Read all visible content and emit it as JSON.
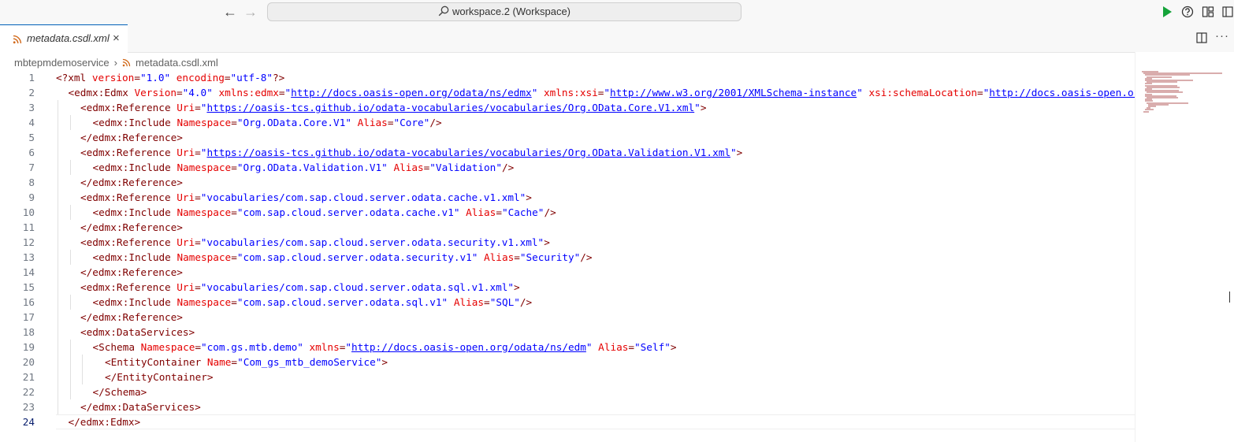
{
  "titlebar": {
    "back_glyph": "←",
    "forward_glyph": "→",
    "command_center_label": "workspace.2 (Workspace)"
  },
  "icons": {
    "search": "search-icon",
    "run": "play-icon",
    "help": "help-circle-icon",
    "layout": "layout-icon",
    "rss": "rss-feed-icon",
    "close": "close-icon",
    "split": "split-editor-icon",
    "more": "ellipsis-icon"
  },
  "colors": {
    "run_green": "#15a33a",
    "rss_orange": "#d1691a",
    "tag": "#800000",
    "attribute": "#e50000",
    "string": "#0000ff",
    "line_number": "#6e7681"
  },
  "tab": {
    "label": "metadata.csdl.xml",
    "close_glyph": "×",
    "more_glyph": "···"
  },
  "breadcrumb": {
    "folder": "mbtepmdemoservice",
    "separator": "›",
    "file": "metadata.csdl.xml"
  },
  "editor": {
    "current_line": 24,
    "lines": [
      {
        "n": "1",
        "indent": 0,
        "t": [
          [
            "p",
            "<?"
          ],
          [
            "g",
            "xml"
          ],
          [
            "a",
            " version"
          ],
          [
            "p",
            "="
          ],
          [
            "s",
            "\"1.0\""
          ],
          [
            "a",
            " encoding"
          ],
          [
            "p",
            "="
          ],
          [
            "s",
            "\"utf-8\""
          ],
          [
            "p",
            "?>"
          ]
        ]
      },
      {
        "n": "2",
        "indent": 1,
        "t": [
          [
            "p",
            "<"
          ],
          [
            "g",
            "edmx:Edmx"
          ],
          [
            "a",
            " Version"
          ],
          [
            "p",
            "="
          ],
          [
            "s",
            "\"4.0\""
          ],
          [
            "a",
            " xmlns:edmx"
          ],
          [
            "p",
            "="
          ],
          [
            "s",
            "\""
          ],
          [
            "l",
            "http://docs.oasis-open.org/odata/ns/edmx"
          ],
          [
            "s",
            "\""
          ],
          [
            "a",
            " xmlns:xsi"
          ],
          [
            "p",
            "="
          ],
          [
            "s",
            "\""
          ],
          [
            "l",
            "http://www.w3.org/2001/XMLSchema-instance"
          ],
          [
            "s",
            "\""
          ],
          [
            "a",
            " xsi:schemaLocation"
          ],
          [
            "p",
            "="
          ],
          [
            "s",
            "\""
          ],
          [
            "l",
            "http://docs.oasis-open.org/odata/ns/edmx"
          ]
        ]
      },
      {
        "n": "3",
        "indent": 2,
        "t": [
          [
            "p",
            "<"
          ],
          [
            "g",
            "edmx:Reference"
          ],
          [
            "a",
            " Uri"
          ],
          [
            "p",
            "="
          ],
          [
            "s",
            "\""
          ],
          [
            "l",
            "https://oasis-tcs.github.io/odata-vocabularies/vocabularies/Org.OData.Core.V1.xml"
          ],
          [
            "s",
            "\""
          ],
          [
            "p",
            ">"
          ]
        ]
      },
      {
        "n": "4",
        "indent": 3,
        "t": [
          [
            "p",
            "<"
          ],
          [
            "g",
            "edmx:Include"
          ],
          [
            "a",
            " Namespace"
          ],
          [
            "p",
            "="
          ],
          [
            "s",
            "\"Org.OData.Core.V1\""
          ],
          [
            "a",
            " Alias"
          ],
          [
            "p",
            "="
          ],
          [
            "s",
            "\"Core\""
          ],
          [
            "p",
            "/>"
          ]
        ]
      },
      {
        "n": "5",
        "indent": 2,
        "t": [
          [
            "p",
            "</"
          ],
          [
            "g",
            "edmx:Reference"
          ],
          [
            "p",
            ">"
          ]
        ]
      },
      {
        "n": "6",
        "indent": 2,
        "t": [
          [
            "p",
            "<"
          ],
          [
            "g",
            "edmx:Reference"
          ],
          [
            "a",
            " Uri"
          ],
          [
            "p",
            "="
          ],
          [
            "s",
            "\""
          ],
          [
            "l",
            "https://oasis-tcs.github.io/odata-vocabularies/vocabularies/Org.OData.Validation.V1.xml"
          ],
          [
            "s",
            "\""
          ],
          [
            "p",
            ">"
          ]
        ]
      },
      {
        "n": "7",
        "indent": 3,
        "t": [
          [
            "p",
            "<"
          ],
          [
            "g",
            "edmx:Include"
          ],
          [
            "a",
            " Namespace"
          ],
          [
            "p",
            "="
          ],
          [
            "s",
            "\"Org.OData.Validation.V1\""
          ],
          [
            "a",
            " Alias"
          ],
          [
            "p",
            "="
          ],
          [
            "s",
            "\"Validation\""
          ],
          [
            "p",
            "/>"
          ]
        ]
      },
      {
        "n": "8",
        "indent": 2,
        "t": [
          [
            "p",
            "</"
          ],
          [
            "g",
            "edmx:Reference"
          ],
          [
            "p",
            ">"
          ]
        ]
      },
      {
        "n": "9",
        "indent": 2,
        "t": [
          [
            "p",
            "<"
          ],
          [
            "g",
            "edmx:Reference"
          ],
          [
            "a",
            " Uri"
          ],
          [
            "p",
            "="
          ],
          [
            "s",
            "\"vocabularies/com.sap.cloud.server.odata.cache.v1.xml\""
          ],
          [
            "p",
            ">"
          ]
        ]
      },
      {
        "n": "10",
        "indent": 3,
        "t": [
          [
            "p",
            "<"
          ],
          [
            "g",
            "edmx:Include"
          ],
          [
            "a",
            " Namespace"
          ],
          [
            "p",
            "="
          ],
          [
            "s",
            "\"com.sap.cloud.server.odata.cache.v1\""
          ],
          [
            "a",
            " Alias"
          ],
          [
            "p",
            "="
          ],
          [
            "s",
            "\"Cache\""
          ],
          [
            "p",
            "/>"
          ]
        ]
      },
      {
        "n": "11",
        "indent": 2,
        "t": [
          [
            "p",
            "</"
          ],
          [
            "g",
            "edmx:Reference"
          ],
          [
            "p",
            ">"
          ]
        ]
      },
      {
        "n": "12",
        "indent": 2,
        "t": [
          [
            "p",
            "<"
          ],
          [
            "g",
            "edmx:Reference"
          ],
          [
            "a",
            " Uri"
          ],
          [
            "p",
            "="
          ],
          [
            "s",
            "\"vocabularies/com.sap.cloud.server.odata.security.v1.xml\""
          ],
          [
            "p",
            ">"
          ]
        ]
      },
      {
        "n": "13",
        "indent": 3,
        "t": [
          [
            "p",
            "<"
          ],
          [
            "g",
            "edmx:Include"
          ],
          [
            "a",
            " Namespace"
          ],
          [
            "p",
            "="
          ],
          [
            "s",
            "\"com.sap.cloud.server.odata.security.v1\""
          ],
          [
            "a",
            " Alias"
          ],
          [
            "p",
            "="
          ],
          [
            "s",
            "\"Security\""
          ],
          [
            "p",
            "/>"
          ]
        ]
      },
      {
        "n": "14",
        "indent": 2,
        "t": [
          [
            "p",
            "</"
          ],
          [
            "g",
            "edmx:Reference"
          ],
          [
            "p",
            ">"
          ]
        ]
      },
      {
        "n": "15",
        "indent": 2,
        "t": [
          [
            "p",
            "<"
          ],
          [
            "g",
            "edmx:Reference"
          ],
          [
            "a",
            " Uri"
          ],
          [
            "p",
            "="
          ],
          [
            "s",
            "\"vocabularies/com.sap.cloud.server.odata.sql.v1.xml\""
          ],
          [
            "p",
            ">"
          ]
        ]
      },
      {
        "n": "16",
        "indent": 3,
        "t": [
          [
            "p",
            "<"
          ],
          [
            "g",
            "edmx:Include"
          ],
          [
            "a",
            " Namespace"
          ],
          [
            "p",
            "="
          ],
          [
            "s",
            "\"com.sap.cloud.server.odata.sql.v1\""
          ],
          [
            "a",
            " Alias"
          ],
          [
            "p",
            "="
          ],
          [
            "s",
            "\"SQL\""
          ],
          [
            "p",
            "/>"
          ]
        ]
      },
      {
        "n": "17",
        "indent": 2,
        "t": [
          [
            "p",
            "</"
          ],
          [
            "g",
            "edmx:Reference"
          ],
          [
            "p",
            ">"
          ]
        ]
      },
      {
        "n": "18",
        "indent": 2,
        "t": [
          [
            "p",
            "<"
          ],
          [
            "g",
            "edmx:DataServices"
          ],
          [
            "p",
            ">"
          ]
        ]
      },
      {
        "n": "19",
        "indent": 3,
        "t": [
          [
            "p",
            "<"
          ],
          [
            "g",
            "Schema"
          ],
          [
            "a",
            " Namespace"
          ],
          [
            "p",
            "="
          ],
          [
            "s",
            "\"com.gs.mtb.demo\""
          ],
          [
            "a",
            " xmlns"
          ],
          [
            "p",
            "="
          ],
          [
            "s",
            "\""
          ],
          [
            "l",
            "http://docs.oasis-open.org/odata/ns/edm"
          ],
          [
            "s",
            "\""
          ],
          [
            "a",
            " Alias"
          ],
          [
            "p",
            "="
          ],
          [
            "s",
            "\"Self\""
          ],
          [
            "p",
            ">"
          ]
        ]
      },
      {
        "n": "20",
        "indent": 4,
        "t": [
          [
            "p",
            "<"
          ],
          [
            "g",
            "EntityContainer"
          ],
          [
            "a",
            " Name"
          ],
          [
            "p",
            "="
          ],
          [
            "s",
            "\"Com_gs_mtb_demoService\""
          ],
          [
            "p",
            ">"
          ]
        ]
      },
      {
        "n": "21",
        "indent": 4,
        "t": [
          [
            "p",
            "</"
          ],
          [
            "g",
            "EntityContainer"
          ],
          [
            "p",
            ">"
          ]
        ]
      },
      {
        "n": "22",
        "indent": 3,
        "t": [
          [
            "p",
            "</"
          ],
          [
            "g",
            "Schema"
          ],
          [
            "p",
            ">"
          ]
        ]
      },
      {
        "n": "23",
        "indent": 2,
        "t": [
          [
            "p",
            "</"
          ],
          [
            "g",
            "edmx:DataServices"
          ],
          [
            "p",
            ">"
          ]
        ]
      },
      {
        "n": "24",
        "indent": 1,
        "t": [
          [
            "p",
            "</"
          ],
          [
            "g",
            "edmx:Edmx"
          ],
          [
            "p",
            ">"
          ]
        ]
      }
    ]
  }
}
